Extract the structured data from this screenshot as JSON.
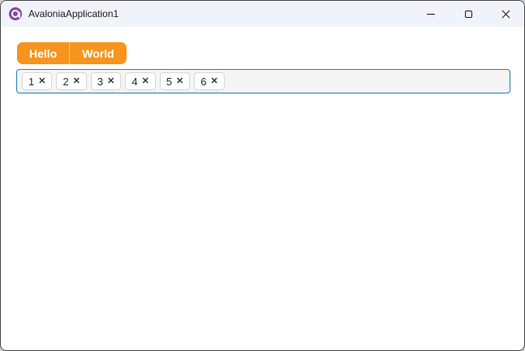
{
  "window": {
    "title": "AvaloniaApplication1",
    "controls": {
      "minimize": {
        "icon": "minimize-icon"
      },
      "maximize": {
        "icon": "maximize-icon"
      },
      "close": {
        "icon": "close-icon"
      }
    }
  },
  "tabstrip": {
    "tabs": [
      {
        "label": "Hello"
      },
      {
        "label": "World"
      }
    ]
  },
  "chipbox": {
    "chips": [
      {
        "value": "1"
      },
      {
        "value": "2"
      },
      {
        "value": "3"
      },
      {
        "value": "4"
      },
      {
        "value": "5"
      },
      {
        "value": "6"
      }
    ],
    "remove_glyph": "✕"
  },
  "colors": {
    "accent_orange": "#F7941D",
    "focus_border_blue": "#2E7BB8",
    "titlebar_bg": "#F0F3F9",
    "logo_purple": "#8B44AC",
    "chip_border": "#D7D7D7",
    "window_border": "#454545"
  }
}
